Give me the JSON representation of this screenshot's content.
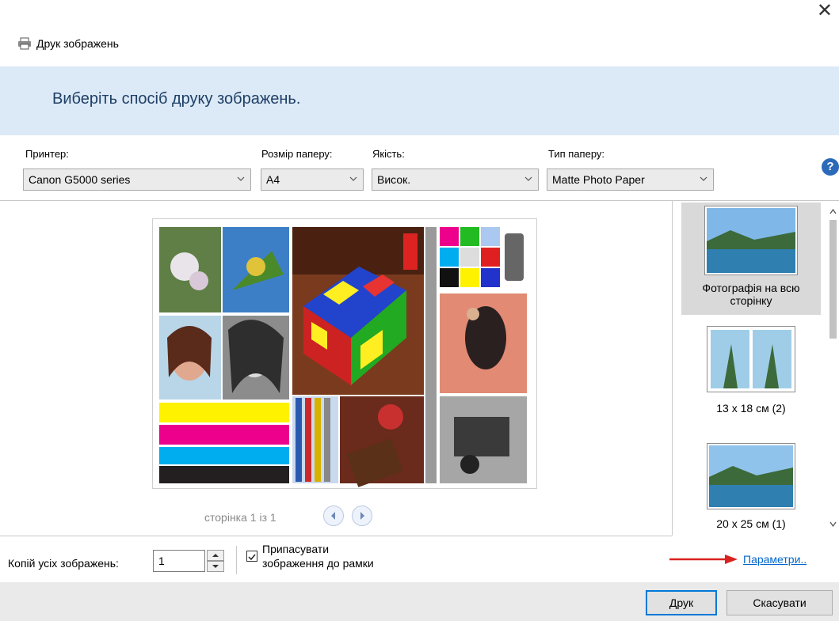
{
  "window": {
    "title": "Друк зображень",
    "close_icon": "close-icon"
  },
  "banner": {
    "heading": "Виберіть спосіб друку зображень."
  },
  "controls": {
    "printer": {
      "label": "Принтер:",
      "value": "Canon G5000 series"
    },
    "paper_size": {
      "label": "Розмір паперу:",
      "value": "A4"
    },
    "quality": {
      "label": "Якість:",
      "value": "Висок."
    },
    "paper_type": {
      "label": "Тип паперу:",
      "value": "Matte Photo Paper"
    },
    "help_icon": "?"
  },
  "preview": {
    "page_indicator": "сторінка 1 із 1",
    "prev_icon": "chevron-left-icon",
    "next_icon": "chevron-right-icon"
  },
  "layouts": [
    {
      "label": "Фотографія на всю сторінку",
      "selected": true
    },
    {
      "label": "13 x 18 см (2)",
      "selected": false
    },
    {
      "label": "20 x 25 см (1)",
      "selected": false
    }
  ],
  "options": {
    "copies_label": "Копій усіх зображень:",
    "copies_value": "1",
    "fit_label_line1": "Припасувати",
    "fit_label_line2": "зображення до рамки",
    "fit_checked": true,
    "params_link": "Параметри.."
  },
  "actions": {
    "print": "Друк",
    "cancel": "Скасувати"
  },
  "colors": {
    "banner": "#dce9f6",
    "accent": "#0078d7",
    "link": "#0066cc",
    "arrow": "#d9221f"
  }
}
